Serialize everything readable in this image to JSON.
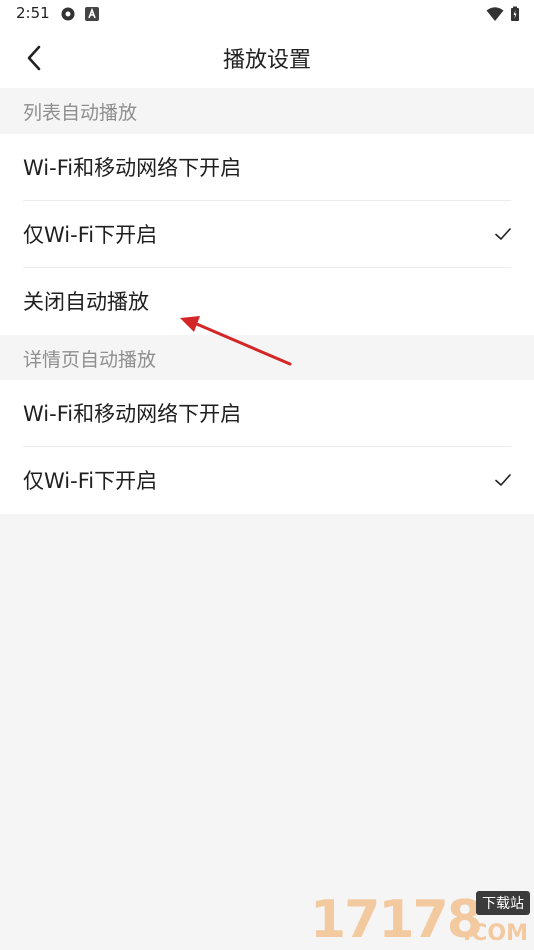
{
  "status_bar": {
    "time": "2:51"
  },
  "header": {
    "title": "播放设置",
    "back_icon": "chevron-left-icon"
  },
  "sections": [
    {
      "title": "列表自动播放",
      "options": [
        {
          "label": "Wi-Fi和移动网络下开启",
          "selected": false
        },
        {
          "label": "仅Wi-Fi下开启",
          "selected": true
        },
        {
          "label": "关闭自动播放",
          "selected": false
        }
      ]
    },
    {
      "title": "详情页自动播放",
      "options": [
        {
          "label": "Wi-Fi和移动网络下开启",
          "selected": false
        },
        {
          "label": "仅Wi-Fi下开启",
          "selected": true
        }
      ]
    }
  ],
  "watermark": {
    "number": "17178",
    "badge": "下载站",
    "suffix": ".COM"
  },
  "colors": {
    "accent_arrow": "#d32626",
    "background": "#f5f5f5",
    "text": "#1f1f1f",
    "muted": "#8f8f8f"
  }
}
